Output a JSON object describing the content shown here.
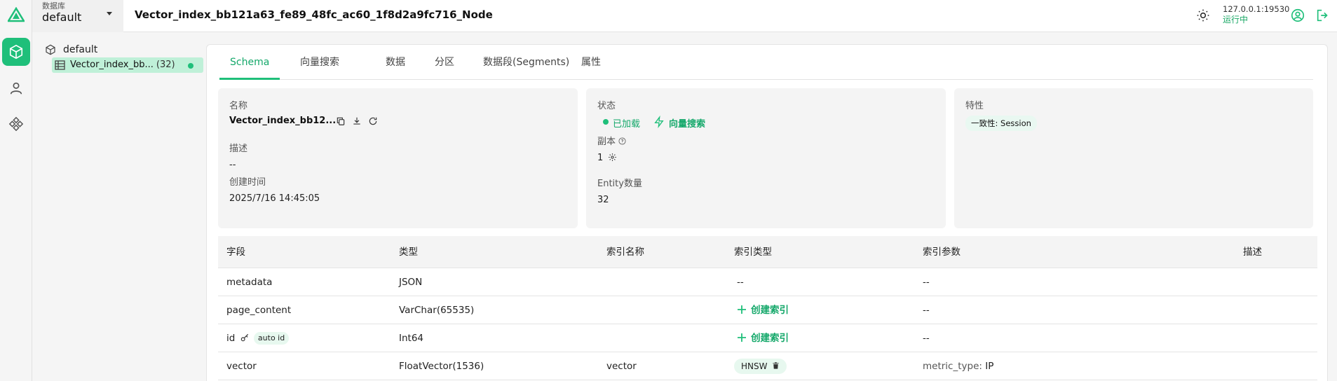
{
  "sidebar": {
    "icons": [
      "milvus-logo-icon",
      "collection-cube-icon",
      "user-icon",
      "system-diamond-icon"
    ]
  },
  "header": {
    "db_label": "数据库",
    "db_value": "default",
    "title": "Vector_index_bb121a63_fe89_48fc_ac60_1f8d2a9fc716_Node",
    "host": "127.0.0.1:19530",
    "status": "运行中"
  },
  "tree": {
    "db": "default",
    "collection": "Vector_index_bb...",
    "count": "(32)"
  },
  "tabs": [
    "Schema",
    "向量搜索",
    "数据",
    "分区",
    "数据段(Segments)",
    "属性"
  ],
  "info": {
    "name_label": "名称",
    "name_value": "Vector_index_bb12...",
    "desc_label": "描述",
    "desc_value": "--",
    "created_label": "创建时间",
    "created_value": "2025/7/16 14:45:05",
    "status_label": "状态",
    "loaded": "已加载",
    "vector_search": "向量搜索",
    "replica_label": "副本",
    "replica_value": "1",
    "entity_label": "Entity数量",
    "entity_value": "32",
    "feature_label": "特性",
    "consistency": "一致性: Session"
  },
  "table": {
    "headers": [
      "字段",
      "类型",
      "索引名称",
      "索引类型",
      "索引参数",
      "描述"
    ],
    "rows": [
      {
        "field": "metadata",
        "type": "JSON",
        "index_name": "",
        "index_type": "--",
        "params": "--"
      },
      {
        "field": "page_content",
        "type": "VarChar(65535)",
        "index_name": "",
        "index_type": "创建索引",
        "params": "--"
      },
      {
        "field": "id",
        "badge": "auto id",
        "type": "Int64",
        "index_name": "",
        "index_type": "创建索引",
        "params": "--"
      },
      {
        "field": "vector",
        "type": "FloatVector(1536)",
        "index_name": "vector",
        "index_type": "HNSW",
        "params_key": "metric_type:",
        "params_val": "IP"
      }
    ]
  },
  "colors": {
    "accent": "#1fbf7a",
    "accent_text": "#14a86a"
  }
}
